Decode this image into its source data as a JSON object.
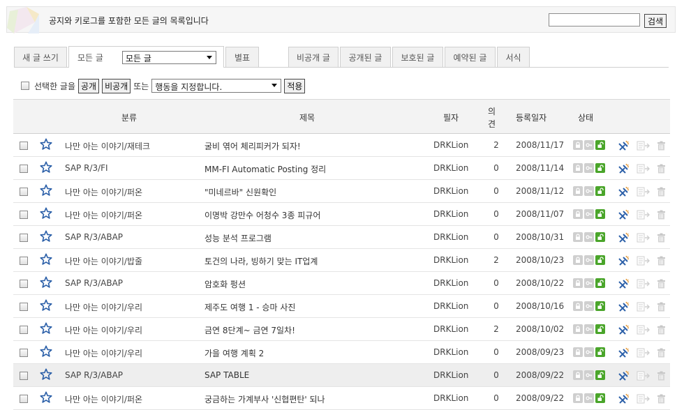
{
  "header": {
    "notice": "공지와 키로그를 포함한 모든 글의 목록입니다",
    "search_value": "",
    "search_button": "검색"
  },
  "tabs": {
    "new_post": "새 글 쓰기",
    "all_posts": "모든 글",
    "category_selected": "모든 글",
    "tags": "별표",
    "private": "비공개 글",
    "public": "공개된 글",
    "protected": "보호된 글",
    "scheduled": "예약된 글",
    "template": "서식"
  },
  "actions": {
    "selected_label": "선택한 글을",
    "public_btn": "공개",
    "private_btn": "비공개",
    "or_label": "또는",
    "action_select": "행동을 지정합니다.",
    "apply_btn": "적용"
  },
  "columns": {
    "category": "분류",
    "title": "제목",
    "author": "필자",
    "comments_1": "의",
    "comments_2": "견",
    "date": "등록일자",
    "status": "상태"
  },
  "posts": [
    {
      "category": "나만 아는 이야기/재테크",
      "title": "굴비 엮어 체리피커가 되자!",
      "author": "DRKLion",
      "comments": "2",
      "date": "2008/11/17"
    },
    {
      "category": "SAP R/3/FI",
      "title": "MM-FI Automatic Posting 정리",
      "author": "DRKLion",
      "comments": "0",
      "date": "2008/11/14"
    },
    {
      "category": "나만 아는 이야기/퍼온",
      "title": "\"미네르바\" 신원확인",
      "author": "DRKLion",
      "comments": "0",
      "date": "2008/11/12"
    },
    {
      "category": "나만 아는 이야기/퍼온",
      "title": "이명박 강만수 어청수 3종 피규어",
      "author": "DRKLion",
      "comments": "0",
      "date": "2008/11/07"
    },
    {
      "category": "SAP R/3/ABAP",
      "title": "성능 분석 프로그램",
      "author": "DRKLion",
      "comments": "0",
      "date": "2008/10/31"
    },
    {
      "category": "나만 아는 이야기/밥줄",
      "title": "토건의 나라, 빙하기 맞는 IT업계",
      "author": "DRKLion",
      "comments": "2",
      "date": "2008/10/23"
    },
    {
      "category": "SAP R/3/ABAP",
      "title": "암호화 펑션",
      "author": "DRKLion",
      "comments": "0",
      "date": "2008/10/22"
    },
    {
      "category": "나만 아는 이야기/우리",
      "title": "제주도 여행 1 - 승마 사진",
      "author": "DRKLion",
      "comments": "0",
      "date": "2008/10/16"
    },
    {
      "category": "나만 아는 이야기/우리",
      "title": "금연 8단계~ 금연 7일차!",
      "author": "DRKLion",
      "comments": "2",
      "date": "2008/10/02"
    },
    {
      "category": "나만 아는 이야기/우리",
      "title": "가을 여행 계획 2",
      "author": "DRKLion",
      "comments": "0",
      "date": "2008/09/23"
    },
    {
      "category": "SAP R/3/ABAP",
      "title": "SAP TABLE",
      "author": "DRKLion",
      "comments": "0",
      "date": "2008/09/22"
    },
    {
      "category": "나만 아는 이야기/퍼온",
      "title": "궁금하는 가계부사 '신협편탄' 되나",
      "author": "DRKLion",
      "comments": "0",
      "date": "2008/09/22"
    }
  ],
  "colors": {
    "status_green": "#4aa52a",
    "star_blue": "#2b5fa8",
    "header_bg": "#f3f3f3"
  }
}
